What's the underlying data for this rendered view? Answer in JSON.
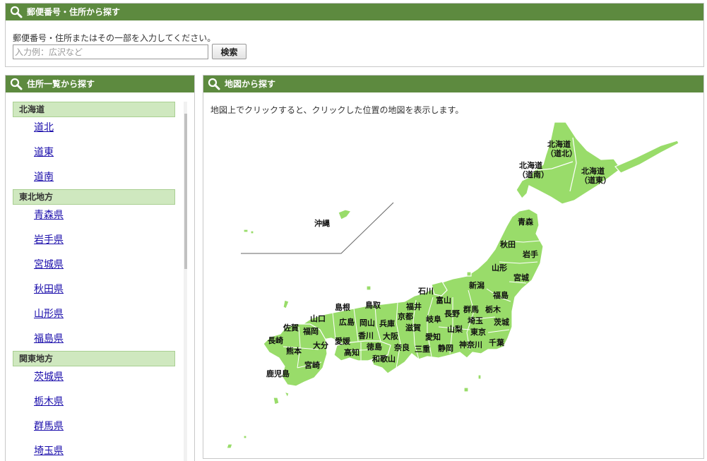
{
  "search": {
    "title": "郵便番号・住所から探す",
    "description": "郵便番号・住所またはその一部を入力してください。",
    "placeholder": "入力例：広沢など",
    "button_label": "検索"
  },
  "address_list": {
    "title": "住所一覧から探す",
    "regions": [
      {
        "name": "北海道",
        "items": [
          "道北",
          "道東",
          "道南"
        ]
      },
      {
        "name": "東北地方",
        "items": [
          "青森県",
          "岩手県",
          "宮城県",
          "秋田県",
          "山形県",
          "福島県"
        ]
      },
      {
        "name": "関東地方",
        "items": [
          "茨城県",
          "栃木県",
          "群馬県",
          "埼玉県"
        ]
      }
    ]
  },
  "map": {
    "title": "地図から探す",
    "description": "地図上でクリックすると、クリックした位置の地図を表示します。",
    "labels": {
      "hokkaido_north": [
        "北海道",
        "（道北）"
      ],
      "hokkaido_east": [
        "北海道",
        "（道東）"
      ],
      "hokkaido_south": [
        "北海道",
        "（道南）"
      ],
      "okinawa": "沖縄",
      "aomori": "青森",
      "akita": "秋田",
      "iwate": "岩手",
      "yamagata": "山形",
      "miyagi": "宮城",
      "niigata": "新潟",
      "fukushima": "福島",
      "ishikawa": "石川",
      "toyama": "富山",
      "gunma": "群馬",
      "tochigi": "栃木",
      "ibaraki": "茨城",
      "fukui": "福井",
      "nagano": "長野",
      "saitama": "埼玉",
      "gifu": "岐阜",
      "yamanashi": "山梨",
      "tokyo": "東京",
      "kanagawa": "神奈川",
      "chiba": "千葉",
      "shizuoka": "静岡",
      "aichi": "愛知",
      "mie": "三重",
      "kyoto": "京都",
      "shiga": "滋賀",
      "hyogo": "兵庫",
      "osaka": "大阪",
      "nara": "奈良",
      "wakayama": "和歌山",
      "tottori": "鳥取",
      "shimane": "島根",
      "okayama": "岡山",
      "hiroshima": "広島",
      "yamaguchi": "山口",
      "kagawa": "香川",
      "tokushima": "徳島",
      "ehime": "愛媛",
      "kochi": "高知",
      "fukuoka": "福岡",
      "saga": "佐賀",
      "nagasaki": "長崎",
      "kumamoto": "熊本",
      "oita": "大分",
      "miyazaki": "宮崎",
      "kagoshima": "鹿児島"
    },
    "land_color": "#99dc6a",
    "header_color": "#5d8a3f"
  }
}
